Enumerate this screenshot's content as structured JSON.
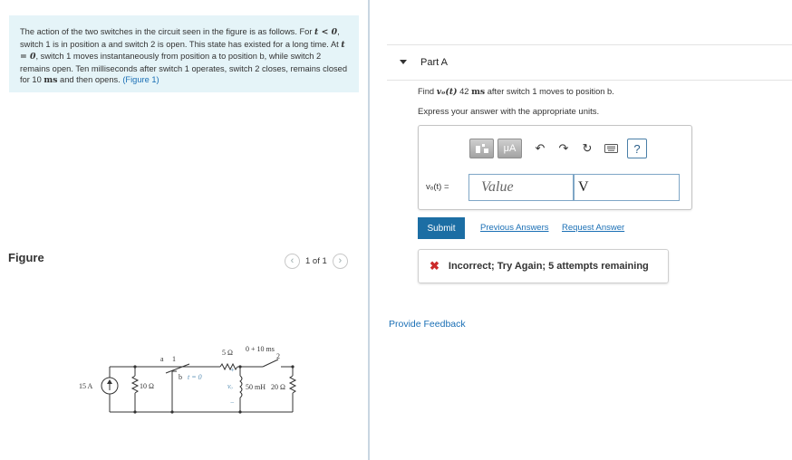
{
  "problem": {
    "s1": "The action of the two switches in the circuit seen in the figure is as follows. For",
    "t_lt": "t < 0",
    "s2": ", switch 1 is in position a and switch 2 is open. This state has existed for a long time. At",
    "t_eq": "t = 0",
    "s3": ", switch 1 moves instantaneously from position a to position b, while switch 2 remains open. Ten milliseconds after switch 1 operates, switch 2 closes, remains closed for 10",
    "ms": "ms",
    "s4": "and then opens.",
    "figure_link": "(Figure 1)"
  },
  "figure": {
    "title": "Figure",
    "pager": "1 of 1",
    "prev_icon": "chevron-left-icon",
    "next_icon": "chevron-right-icon",
    "circuit_labels": {
      "source": "15 A",
      "r10": "10 Ω",
      "a": "a",
      "one": "1",
      "b": "b",
      "t0": "t = 0",
      "r5": "5 Ω",
      "timing": "0 + 10 ms",
      "two": "2",
      "plus": "+",
      "vo": "vₒ",
      "minus": "−",
      "inductor": "50 mH",
      "r20": "20 Ω"
    }
  },
  "part": {
    "title": "Part A",
    "caret_icon": "caret-down-icon"
  },
  "question": {
    "find": "Find",
    "var": "vₒ(t)",
    "value": "42",
    "unit": "ms",
    "rest": "after switch 1 moves to position b.",
    "instruction": "Express your answer with the appropriate units."
  },
  "toolbar": {
    "template_icon": "template-icon",
    "units_label": "μA",
    "undo_icon": "undo-icon",
    "redo_icon": "redo-icon",
    "reset_icon": "reset-icon",
    "keyboard_icon": "keyboard-icon",
    "help_label": "?"
  },
  "answer": {
    "var_label": "vₒ(t) =",
    "value_placeholder": "Value",
    "unit_value": "V"
  },
  "actions": {
    "submit": "Submit",
    "previous_answers": "Previous Answers",
    "request_answer": "Request Answer"
  },
  "feedback": {
    "icon": "x-icon",
    "message": "Incorrect; Try Again; 5 attempts remaining"
  },
  "provide_feedback": "Provide Feedback",
  "colors": {
    "problem_bg": "#e5f4f8",
    "link": "#1a6fb5",
    "submit_bg": "#1c6ea4",
    "error": "#cc2a2a"
  }
}
